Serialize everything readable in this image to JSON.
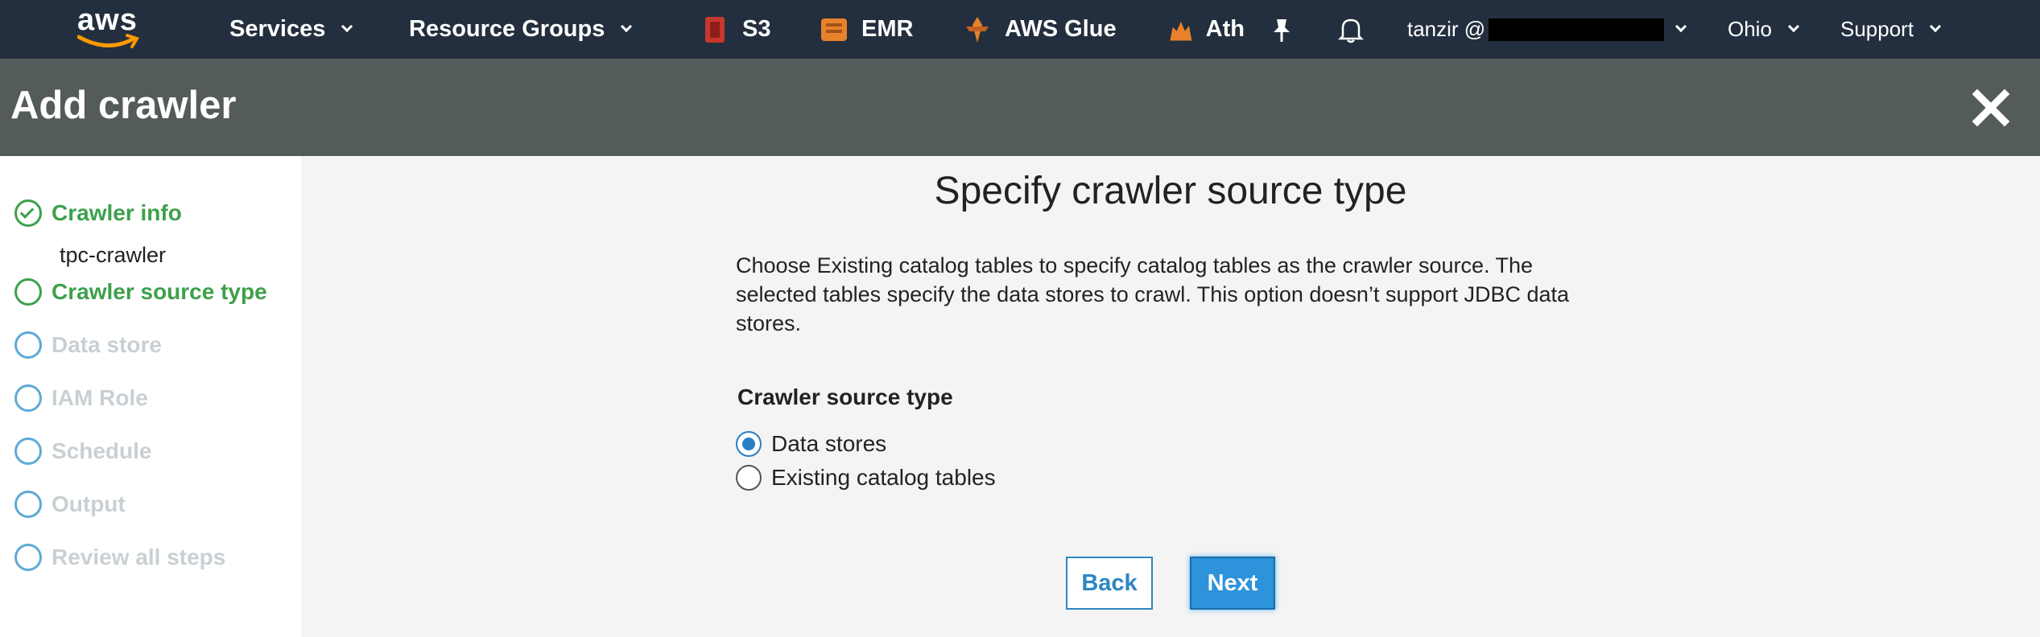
{
  "topnav": {
    "logo_text": "aws",
    "services_label": "Services",
    "resource_groups_label": "Resource Groups",
    "shortcuts": [
      {
        "label": "S3",
        "icon": "s3-icon",
        "color": "#c7372f"
      },
      {
        "label": "EMR",
        "icon": "emr-icon",
        "color": "#e8822a"
      },
      {
        "label": "AWS Glue",
        "icon": "glue-icon",
        "color": "#e8822a"
      },
      {
        "label": "Ath",
        "icon": "athena-icon",
        "color": "#e8822a"
      }
    ],
    "pin_icon": "pin-icon",
    "bell_icon": "bell-icon",
    "user_label": "tanzir @",
    "region_label": "Ohio",
    "support_label": "Support"
  },
  "header": {
    "title": "Add crawler",
    "close_icon": "close-icon"
  },
  "sidebar": {
    "steps": [
      {
        "label": "Crawler info",
        "state": "done"
      },
      {
        "label": "Crawler source type",
        "state": "active"
      },
      {
        "label": "Data store",
        "state": "pending"
      },
      {
        "label": "IAM Role",
        "state": "pending"
      },
      {
        "label": "Schedule",
        "state": "pending"
      },
      {
        "label": "Output",
        "state": "pending"
      },
      {
        "label": "Review all steps",
        "state": "pending"
      }
    ],
    "crawler_name": "tpc-crawler"
  },
  "main": {
    "title": "Specify crawler source type",
    "description": "Choose Existing catalog tables to specify catalog tables as the crawler source. The selected tables specify the data stores to crawl. This option doesn’t support JDBC data stores.",
    "field_label": "Crawler source type",
    "options": [
      {
        "label": "Data stores",
        "checked": true
      },
      {
        "label": "Existing catalog tables",
        "checked": false
      }
    ],
    "back_label": "Back",
    "next_label": "Next"
  },
  "colors": {
    "nav_bg": "#232f3e",
    "header_bg": "#545b5b",
    "step_done": "#3ea04b",
    "step_pending": "#5fa9d6",
    "primary_button": "#2d93db"
  }
}
